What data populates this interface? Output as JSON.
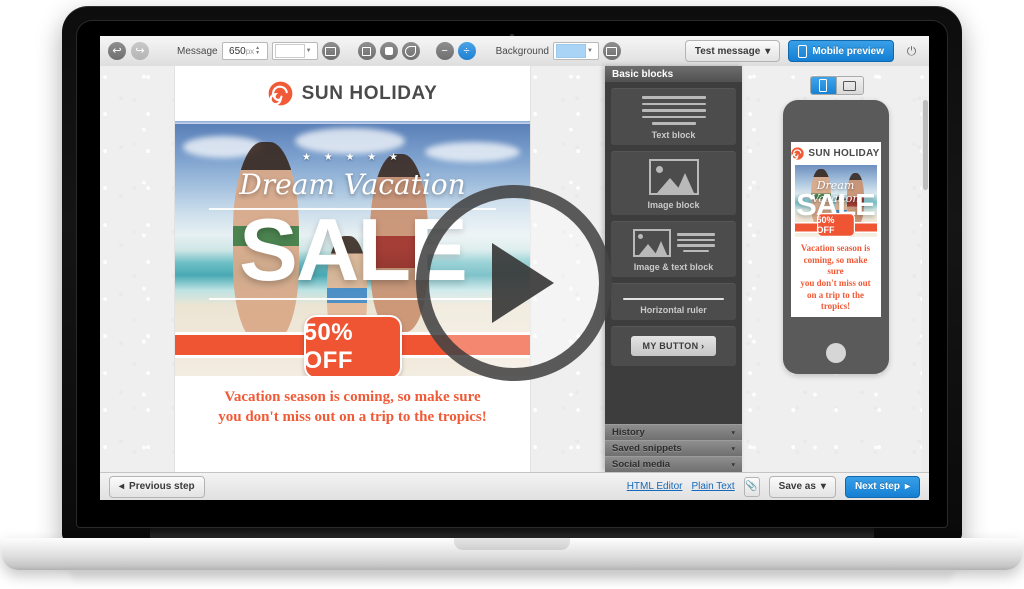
{
  "toolbar": {
    "undo_icon": "undo-arrow-icon",
    "redo_icon": "redo-arrow-icon",
    "message_label": "Message",
    "width_value": "650",
    "width_unit": "px",
    "color_dropdown_value": "",
    "background_label": "Background",
    "background_color": "#a9d4f5",
    "test_message_label": "Test message",
    "mobile_preview_label": "Mobile preview",
    "power_icon": "power-icon",
    "caret": "▾"
  },
  "email": {
    "logo_text": "SUN HOLIDAY",
    "hero_stars": "★ ★ ★ ★ ★",
    "hero_script": "Dream Vacation",
    "hero_sale": "SALE",
    "badge_text": "50% OFF",
    "footer_line1": "Vacation season is coming, so make sure",
    "footer_line2": "you don't miss out on a trip to the tropics!",
    "accent_color": "#ef5433",
    "logo_color": "#4a4a4a"
  },
  "blocks_panel": {
    "title": "Basic blocks",
    "items": [
      {
        "label": "Text block",
        "icon": "text-lines-icon"
      },
      {
        "label": "Image block",
        "icon": "image-icon"
      },
      {
        "label": "Image & text block",
        "icon": "image-text-icon"
      },
      {
        "label": "Horizontal ruler",
        "icon": "horizontal-rule-icon"
      },
      {
        "label": "MY BUTTON ›",
        "icon": "button-icon"
      }
    ],
    "accordions": [
      {
        "label": "History",
        "caret": "▾"
      },
      {
        "label": "Saved snippets",
        "caret": "▾"
      },
      {
        "label": "Social media",
        "caret": "▾"
      }
    ]
  },
  "mobile_preview": {
    "toggle_portrait_icon": "phone-portrait-icon",
    "toggle_landscape_icon": "phone-landscape-icon",
    "logo_text": "SUN HOLIDAY",
    "hero_script": "Dream Vacation",
    "hero_sale": "SALE",
    "badge_text": "50% OFF",
    "footer_line1": "Vacation season is",
    "footer_line2": "coming, so make sure",
    "footer_line3": "you don't miss out",
    "footer_line4": "on a trip to the tropics!"
  },
  "footer": {
    "previous_step": "Previous step",
    "previous_caret": "◂",
    "html_editor": "HTML Editor",
    "plain_text": "Plain Text",
    "attachment_icon": "paperclip-icon",
    "save_as": "Save as",
    "save_caret": "▾",
    "next_step": "Next step",
    "next_caret": "▸"
  },
  "overlay": {
    "play_icon": "play-button-icon"
  }
}
